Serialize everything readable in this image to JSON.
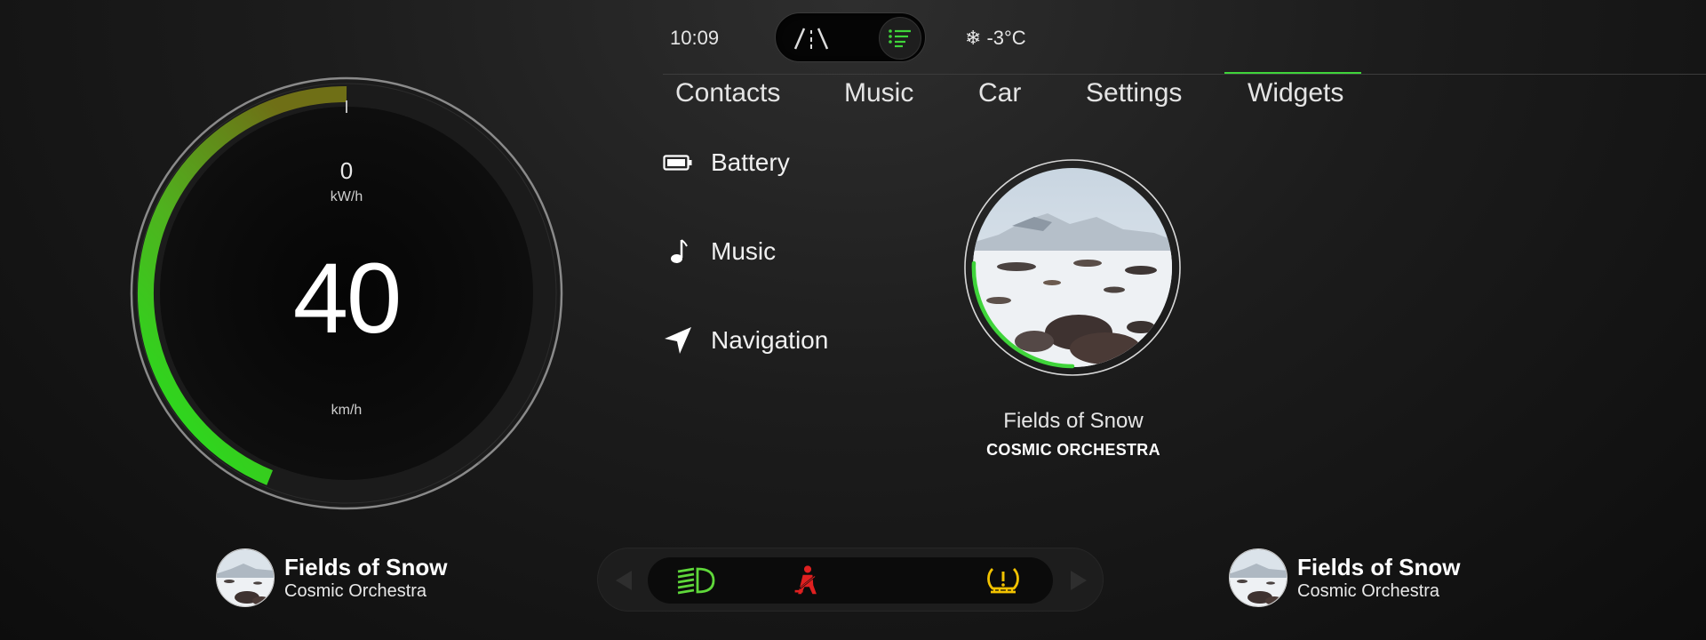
{
  "status": {
    "time": "10:09",
    "temperature": "-3°C",
    "temperature_icon": "snowflake-icon"
  },
  "mode_switch": {
    "options": [
      "road-icon",
      "list-icon"
    ],
    "active": "list-icon"
  },
  "gauge": {
    "power_value": "0",
    "power_unit": "kW/h",
    "speed_value": "40",
    "speed_unit": "km/h"
  },
  "tabs": [
    {
      "label": "Contacts"
    },
    {
      "label": "Music"
    },
    {
      "label": "Car"
    },
    {
      "label": "Settings"
    },
    {
      "label": "Widgets"
    }
  ],
  "active_tab": "Widgets",
  "widget_list": [
    {
      "label": "Battery",
      "icon": "battery-icon"
    },
    {
      "label": "Music",
      "icon": "music-note-icon"
    },
    {
      "label": "Navigation",
      "icon": "navigation-arrow-icon"
    }
  ],
  "album_widget": {
    "title": "Fields of Snow",
    "artist": "COSMIC ORCHESTRA",
    "progress": 0.27
  },
  "now_playing_left": {
    "title": "Fields of Snow",
    "artist": "Cosmic Orchestra"
  },
  "now_playing_right": {
    "title": "Fields of Snow",
    "artist": "Cosmic Orchestra"
  },
  "warnings": [
    {
      "icon": "headlight-icon",
      "color": "#5fd83a"
    },
    {
      "icon": "seatbelt-icon",
      "color": "#e02020"
    },
    {
      "icon": "tire-pressure-icon",
      "color": "#f2c200"
    }
  ],
  "colors": {
    "accent": "#3fd43a",
    "warning_yellow": "#f2c200",
    "warning_red": "#e02020"
  }
}
